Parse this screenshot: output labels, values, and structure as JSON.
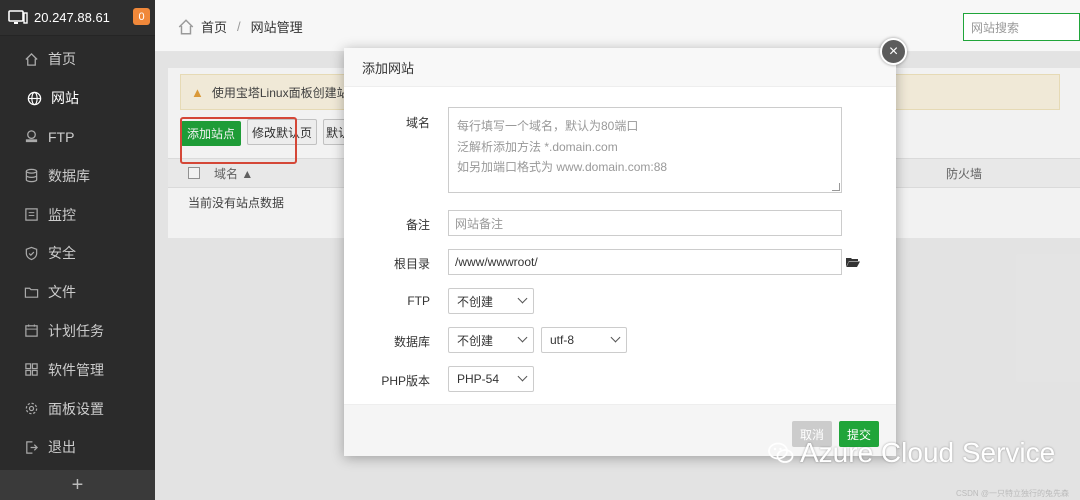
{
  "sidebar": {
    "ip": "20.247.88.61",
    "badge": "0",
    "items": [
      {
        "label": "首页",
        "icon": "home-icon"
      },
      {
        "label": "网站",
        "icon": "globe-icon"
      },
      {
        "label": "FTP",
        "icon": "ftp-icon"
      },
      {
        "label": "数据库",
        "icon": "database-icon"
      },
      {
        "label": "监控",
        "icon": "monitor-icon"
      },
      {
        "label": "安全",
        "icon": "shield-icon"
      },
      {
        "label": "文件",
        "icon": "folder-icon"
      },
      {
        "label": "计划任务",
        "icon": "calendar-icon"
      },
      {
        "label": "软件管理",
        "icon": "grid-icon"
      },
      {
        "label": "面板设置",
        "icon": "gear-icon"
      },
      {
        "label": "退出",
        "icon": "logout-icon"
      }
    ],
    "footer": "+"
  },
  "header": {
    "breadcrumb_home": "首页",
    "breadcrumb_sep": "/",
    "breadcrumb_current": "网站管理",
    "search_placeholder": "网站搜索"
  },
  "content": {
    "alert": "使用宝塔Linux面板创建站点时",
    "add_site": "添加站点",
    "edit_default": "修改默认页",
    "default_site": "默认",
    "col_domain": "域名 ▲",
    "col_firewall": "防火墙",
    "empty": "当前没有站点数据"
  },
  "modal": {
    "title": "添加网站",
    "close": "×",
    "domain_label": "域名",
    "domain_hint1": "每行填写一个域名，默认为80端口",
    "domain_hint2": "泛解析添加方法 *.domain.com",
    "domain_hint3": "如另加端口格式为 www.domain.com:88",
    "remark_label": "备注",
    "remark_placeholder": "网站备注",
    "root_label": "根目录",
    "root_value": "/www/wwwroot/",
    "ftp_label": "FTP",
    "ftp_value": "不创建",
    "db_label": "数据库",
    "db_value": "不创建",
    "charset_value": "utf-8",
    "php_label": "PHP版本",
    "php_value": "PHP-54",
    "cancel": "取消",
    "submit": "提交"
  },
  "watermark": {
    "text": "Azure Cloud Service",
    "csdn": "CSDN @一只特立独行的兔先森"
  },
  "colors": {
    "accent": "#20a53a",
    "sidebar_bg": "#2b2b2b",
    "highlight_box": "#e04b3a",
    "badge": "#f0883a"
  }
}
